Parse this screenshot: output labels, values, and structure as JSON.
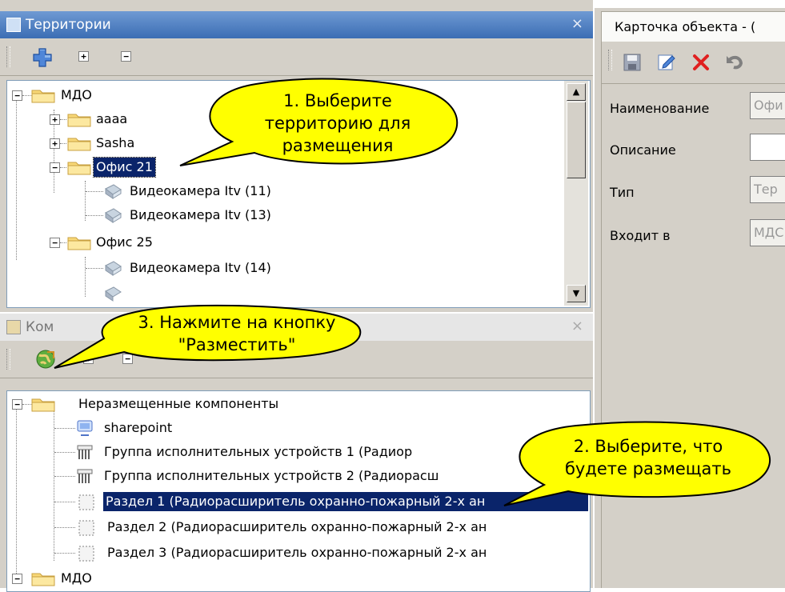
{
  "territories_panel": {
    "title": "Территории",
    "close": "×",
    "toolbar": {
      "expand_label": "+",
      "collapse_label": "−"
    },
    "tree": [
      {
        "label": "МДО",
        "level": 0,
        "expander": "−",
        "icon": "folder-icon"
      },
      {
        "label": "аааа",
        "level": 1,
        "expander": "+",
        "icon": "folder-icon"
      },
      {
        "label": "Sasha",
        "level": 1,
        "expander": "+",
        "icon": "folder-icon"
      },
      {
        "label": "Офис 21",
        "level": 1,
        "expander": "−",
        "icon": "folder-icon",
        "selected": true
      },
      {
        "label": "Видеокамера Itv (11)",
        "level": 2,
        "icon": "camera-icon"
      },
      {
        "label": "Видеокамера Itv (13)",
        "level": 2,
        "icon": "camera-icon"
      },
      {
        "label": "Офис 25",
        "level": 1,
        "expander": "−",
        "icon": "folder-icon"
      },
      {
        "label": "Видеокамера Itv (14)",
        "level": 2,
        "icon": "camera-icon"
      }
    ]
  },
  "components_panel": {
    "title": "Ком",
    "close": "×",
    "toolbar": {
      "expand_label": "+",
      "collapse_label": "−"
    },
    "tree": [
      {
        "label": "Неразмещенные компоненты",
        "level": 0,
        "expander": "−",
        "icon": "folder-icon"
      },
      {
        "label": "sharepoint",
        "level": 1,
        "icon": "monitor-icon"
      },
      {
        "label": "Группа исполнительных устройств 1 (Радиор",
        "level": 1,
        "icon": "device-group-icon"
      },
      {
        "label": "Группа исполнительных устройств 2 (Радиорасш",
        "level": 1,
        "icon": "device-group-icon"
      },
      {
        "label": "Раздел 1 (Радиорасширитель охранно-пожарный 2-х ан",
        "level": 1,
        "icon": "section-icon",
        "selected": true
      },
      {
        "label": "Раздел 2 (Радиорасширитель охранно-пожарный 2-х ан",
        "level": 1,
        "icon": "section-icon"
      },
      {
        "label": "Раздел 3 (Радиорасширитель охранно-пожарный 2-х ан",
        "level": 1,
        "icon": "section-icon"
      },
      {
        "label": "МДО",
        "level": 0,
        "expander": "−",
        "icon": "folder-icon"
      }
    ]
  },
  "object_card": {
    "tab_title": "Карточка объекта - (",
    "fields": [
      {
        "label": "Наименование",
        "value": "Офи"
      },
      {
        "label": "Описание",
        "value": ""
      },
      {
        "label": "Тип",
        "value": "Тер"
      },
      {
        "label": "Входит в",
        "value": "МДС"
      }
    ]
  },
  "callouts": {
    "one": [
      "1. Выберите",
      "территорию для",
      "размещения"
    ],
    "two": [
      "2. Выберите, что",
      "будете размещать"
    ],
    "three": [
      "3. Нажмите на кнопку",
      "\"Разместить\""
    ]
  },
  "colors": {
    "selection": "#0a246a",
    "callout_fill": "#ffff00",
    "titlebar_active": "#3b6db4"
  }
}
